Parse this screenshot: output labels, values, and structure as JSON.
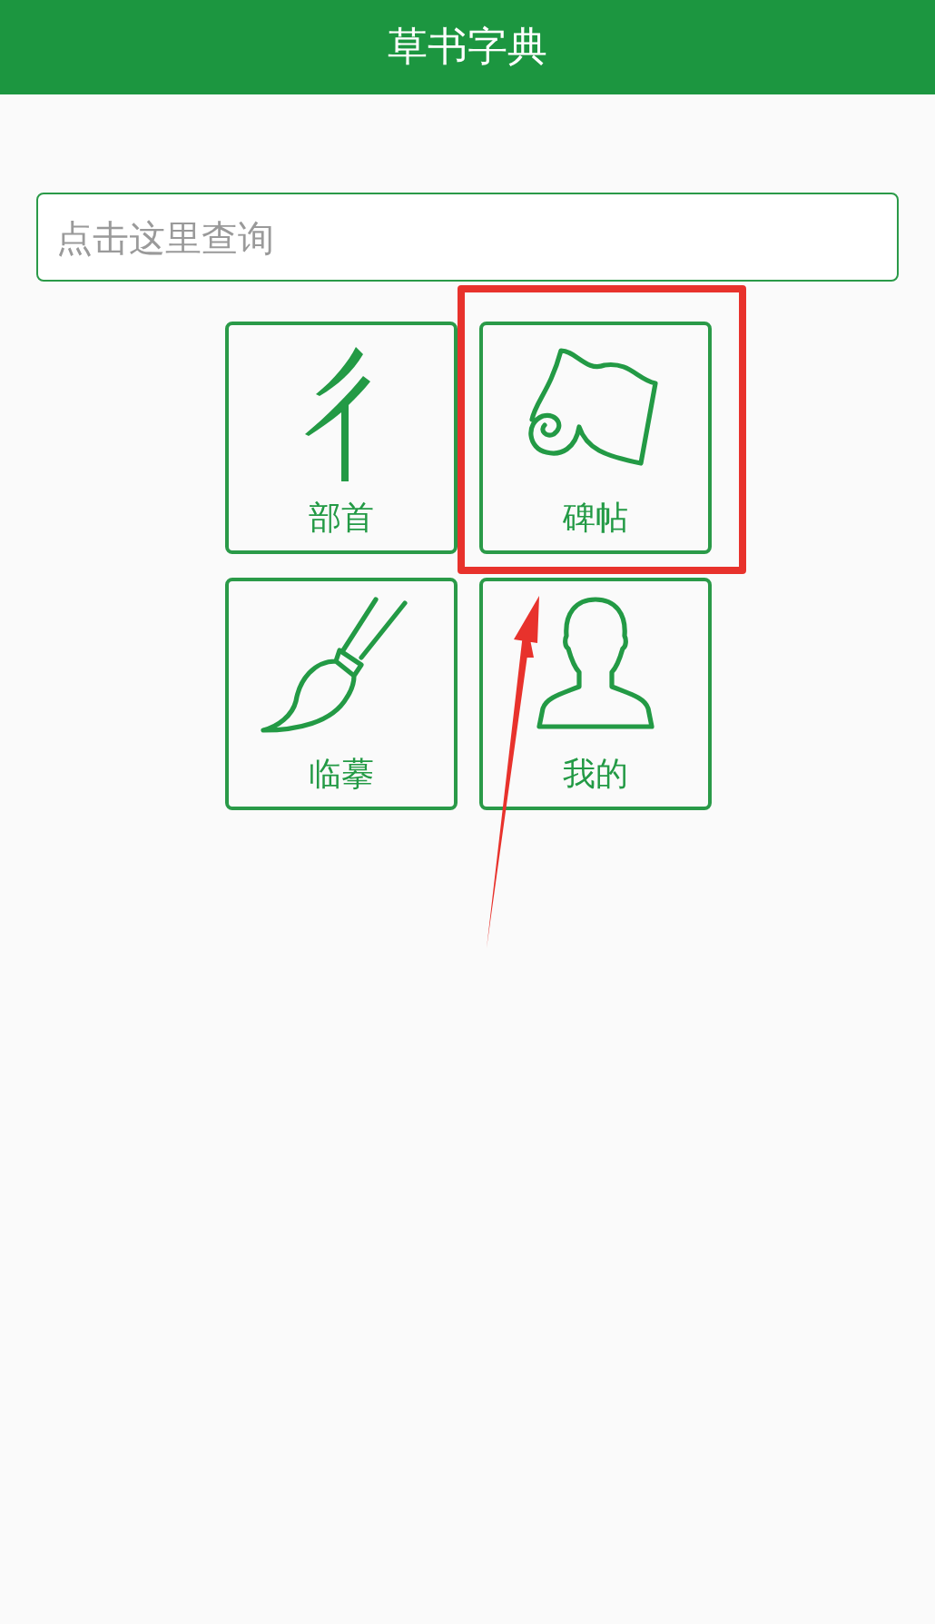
{
  "header": {
    "title": "草书字典"
  },
  "search": {
    "placeholder": "点击这里查询"
  },
  "tiles": [
    {
      "kind": "radical",
      "label": "部首",
      "highlighted": false
    },
    {
      "kind": "scroll",
      "label": "碑帖",
      "highlighted": true
    },
    {
      "kind": "brush",
      "label": "临摹",
      "highlighted": false
    },
    {
      "kind": "person",
      "label": "我的",
      "highlighted": false
    }
  ]
}
